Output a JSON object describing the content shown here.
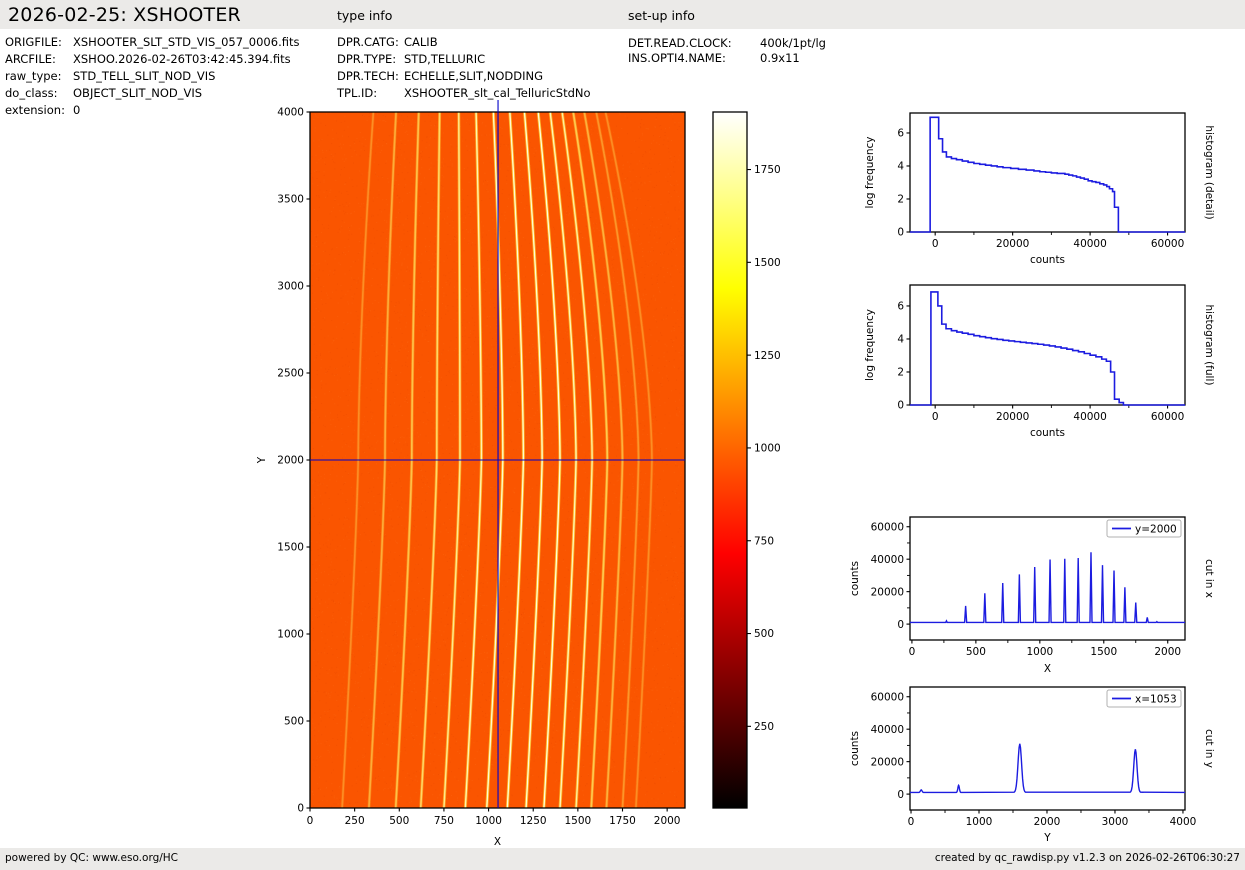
{
  "header": {
    "title": "2026-02-25: XSHOOTER",
    "file_rows": [
      {
        "label": "ORIGFILE:",
        "value": "XSHOOTER_SLT_STD_VIS_057_0006.fits"
      },
      {
        "label": "ARCFILE:",
        "value": "XSHOO.2026-02-26T03:42:45.394.fits"
      },
      {
        "label": "raw_type:",
        "value": "STD_TELL_SLIT_NOD_VIS"
      },
      {
        "label": "do_class:",
        "value": "OBJECT_SLIT_NOD_VIS"
      },
      {
        "label": "extension:",
        "value": "0"
      }
    ],
    "type_info": {
      "heading": "type info",
      "rows": [
        {
          "label": "DPR.CATG:",
          "value": "CALIB"
        },
        {
          "label": "DPR.TYPE:",
          "value": "STD,TELLURIC"
        },
        {
          "label": "DPR.TECH:",
          "value": "ECHELLE,SLIT,NODDING"
        },
        {
          "label": "TPL.ID:",
          "value": "XSHOOTER_slt_cal_TelluricStdNo"
        }
      ]
    },
    "setup_info": {
      "heading": "set-up info",
      "rows": [
        {
          "label": "DET.READ.CLOCK:",
          "value": "400k/1pt/lg"
        },
        {
          "label": "INS.OPTI4.NAME:",
          "value": "0.9x11"
        }
      ]
    }
  },
  "footer": {
    "left": "powered by QC: www.eso.org/HC",
    "right": "created by qc_rawdisp.py v1.2.3 on 2026-02-26T06:30:27"
  },
  "colors": {
    "line_blue": "#1c1ce0",
    "crosshair_blue": "#0000c8",
    "image_background": "#fa5500",
    "order_glow": "#ffc832",
    "order_mid": "#ffeb6e",
    "order_core": "#ffffff",
    "bar_gray": "#ebeae8",
    "axis_black": "#000000",
    "legend_edge": "#b0b0b0"
  },
  "chart_data": [
    {
      "id": "raw_frame",
      "type": "heatmap",
      "xlabel": "X",
      "ylabel": "Y",
      "xlim": [
        0,
        2100
      ],
      "ylim": [
        0,
        4000
      ],
      "xticks": [
        0,
        250,
        500,
        750,
        1000,
        1250,
        1500,
        1750,
        2000
      ],
      "yticks": [
        0,
        500,
        1000,
        1500,
        2000,
        2500,
        3000,
        3500,
        4000
      ],
      "colormap": "hot",
      "background_counts": 1000,
      "crosshair": {
        "x": 1053,
        "y": 2000
      },
      "orders_note": "each order: [x position at y=2000, peak counts]",
      "orders": [
        [
          270,
          2000
        ],
        [
          420,
          11200
        ],
        [
          570,
          19000
        ],
        [
          710,
          25300
        ],
        [
          840,
          30600
        ],
        [
          960,
          35200
        ],
        [
          1080,
          39800
        ],
        [
          1195,
          40300
        ],
        [
          1300,
          40700
        ],
        [
          1400,
          44300
        ],
        [
          1490,
          36300
        ],
        [
          1580,
          33000
        ],
        [
          1665,
          22700
        ],
        [
          1750,
          13300
        ],
        [
          1840,
          4100
        ],
        [
          1915,
          1500
        ]
      ],
      "order_curve": {
        "bottom_drop": 90,
        "bottom_exp": 1.2,
        "top_shift_start": 85,
        "top_shift_step": -23,
        "top_exp": 1.6,
        "pivot_y": 2000
      }
    },
    {
      "id": "colorbar",
      "type": "colorbar",
      "ticks": [
        250,
        500,
        750,
        1000,
        1250,
        1500,
        1750
      ],
      "vmin": 30,
      "vmax": 1905,
      "stops": [
        [
          0,
          "#000000"
        ],
        [
          0.365,
          "#ff0000"
        ],
        [
          0.5,
          "#ff5a00"
        ],
        [
          0.6,
          "#ff9d00"
        ],
        [
          0.746,
          "#ffff00"
        ],
        [
          0.875,
          "#ffff84"
        ],
        [
          1,
          "#ffffff"
        ]
      ]
    },
    {
      "id": "hist_detail",
      "type": "line",
      "style": "step",
      "right_label": "histogram (detail)",
      "xlabel": "counts",
      "ylabel": "log frequency",
      "xlim": [
        -6500,
        64500
      ],
      "ylim": [
        0,
        7.21
      ],
      "xticks": [
        0,
        20000,
        40000,
        60000
      ],
      "xticks_minor": [
        10000,
        30000,
        50000
      ],
      "yticks": [
        0,
        2,
        4,
        6
      ],
      "steps": [
        [
          -1300,
          6.95
        ],
        [
          900,
          5.65
        ],
        [
          1900,
          4.85
        ],
        [
          2900,
          4.55
        ],
        [
          4200,
          4.45
        ],
        [
          5500,
          4.38
        ],
        [
          7000,
          4.3
        ],
        [
          8500,
          4.22
        ],
        [
          10000,
          4.15
        ],
        [
          11500,
          4.1
        ],
        [
          13000,
          4.05
        ],
        [
          14500,
          4.0
        ],
        [
          16000,
          3.95
        ],
        [
          17500,
          3.9
        ],
        [
          19500,
          3.85
        ],
        [
          21500,
          3.8
        ],
        [
          23500,
          3.75
        ],
        [
          25500,
          3.7
        ],
        [
          27000,
          3.65
        ],
        [
          28500,
          3.62
        ],
        [
          30000,
          3.58
        ],
        [
          31500,
          3.55
        ],
        [
          33500,
          3.5
        ],
        [
          34500,
          3.45
        ],
        [
          35500,
          3.4
        ],
        [
          36500,
          3.33
        ],
        [
          37500,
          3.27
        ],
        [
          38500,
          3.2
        ],
        [
          39500,
          3.1
        ],
        [
          40500,
          3.05
        ],
        [
          41500,
          3.0
        ],
        [
          42500,
          2.92
        ],
        [
          43500,
          2.85
        ],
        [
          44300,
          2.75
        ],
        [
          45000,
          2.62
        ],
        [
          45800,
          2.45
        ],
        [
          46300,
          1.5
        ],
        [
          47300,
          0
        ]
      ]
    },
    {
      "id": "hist_full",
      "type": "line",
      "style": "step",
      "right_label": "histogram (full)",
      "xlabel": "counts",
      "ylabel": "log frequency",
      "xlim": [
        -6500,
        64500
      ],
      "ylim": [
        0,
        7.27
      ],
      "xticks": [
        0,
        20000,
        40000,
        60000
      ],
      "xticks_minor": [
        10000,
        30000,
        50000
      ],
      "yticks": [
        0,
        2,
        4,
        6
      ],
      "steps": [
        [
          -1100,
          6.85
        ],
        [
          700,
          6.0
        ],
        [
          1700,
          4.9
        ],
        [
          2800,
          4.62
        ],
        [
          4200,
          4.5
        ],
        [
          5600,
          4.42
        ],
        [
          7000,
          4.35
        ],
        [
          8500,
          4.28
        ],
        [
          10000,
          4.2
        ],
        [
          11500,
          4.14
        ],
        [
          13000,
          4.08
        ],
        [
          14500,
          4.02
        ],
        [
          16000,
          3.97
        ],
        [
          17500,
          3.92
        ],
        [
          19000,
          3.88
        ],
        [
          20500,
          3.84
        ],
        [
          22000,
          3.8
        ],
        [
          23500,
          3.76
        ],
        [
          25000,
          3.72
        ],
        [
          26500,
          3.68
        ],
        [
          28000,
          3.63
        ],
        [
          29500,
          3.58
        ],
        [
          31000,
          3.52
        ],
        [
          32500,
          3.45
        ],
        [
          34000,
          3.38
        ],
        [
          35500,
          3.3
        ],
        [
          37000,
          3.22
        ],
        [
          38500,
          3.12
        ],
        [
          40000,
          3.02
        ],
        [
          41500,
          2.92
        ],
        [
          43000,
          2.78
        ],
        [
          44200,
          2.65
        ],
        [
          45300,
          2.0
        ],
        [
          46300,
          0.35
        ],
        [
          47500,
          0.15
        ],
        [
          48600,
          0
        ]
      ]
    },
    {
      "id": "cut_x",
      "type": "line",
      "style": "peaks",
      "legend": "y=2000",
      "right_label": "cut in x",
      "xlabel": "X",
      "ylabel": "counts",
      "xlim": [
        -15,
        2135
      ],
      "ylim": [
        -9800,
        66000
      ],
      "xticks": [
        0,
        500,
        1000,
        1500,
        2000
      ],
      "xticks_minor": [
        250,
        750,
        1250,
        1750
      ],
      "yticks": [
        0,
        20000,
        40000,
        60000
      ],
      "yticks_minor": [
        10000,
        30000,
        50000
      ],
      "baseline": 1000,
      "peak_shape": "spike",
      "peaks_note": "each peak: [X, counts, half-width]",
      "peaks": [
        [
          270,
          2000,
          6
        ],
        [
          420,
          11200,
          8
        ],
        [
          570,
          19000,
          8
        ],
        [
          710,
          25300,
          8
        ],
        [
          840,
          30600,
          8
        ],
        [
          960,
          35200,
          8
        ],
        [
          1080,
          39800,
          8
        ],
        [
          1195,
          40300,
          8
        ],
        [
          1300,
          40700,
          8
        ],
        [
          1400,
          44300,
          8
        ],
        [
          1490,
          36300,
          8
        ],
        [
          1580,
          33000,
          8
        ],
        [
          1665,
          22700,
          8
        ],
        [
          1750,
          13300,
          8
        ],
        [
          1840,
          4100,
          8
        ],
        [
          1915,
          1500,
          6
        ]
      ]
    },
    {
      "id": "cut_y",
      "type": "line",
      "style": "peaks",
      "legend": "x=1053",
      "right_label": "cut in y",
      "xlabel": "Y",
      "ylabel": "counts",
      "xlim": [
        -15,
        4030
      ],
      "ylim": [
        -9800,
        66000
      ],
      "xticks": [
        0,
        1000,
        2000,
        3000,
        4000
      ],
      "xticks_minor": [
        500,
        1500,
        2500,
        3500
      ],
      "yticks": [
        0,
        20000,
        40000,
        60000
      ],
      "yticks_minor": [
        10000,
        30000,
        50000
      ],
      "baseline": 1000,
      "peak_shape": "gauss",
      "peaks_note": "each peak: [Y, counts, sigma]",
      "peaks": [
        [
          150,
          2600,
          12
        ],
        [
          700,
          5400,
          11
        ],
        [
          1600,
          31000,
          26
        ],
        [
          3300,
          27600,
          24
        ]
      ]
    }
  ]
}
